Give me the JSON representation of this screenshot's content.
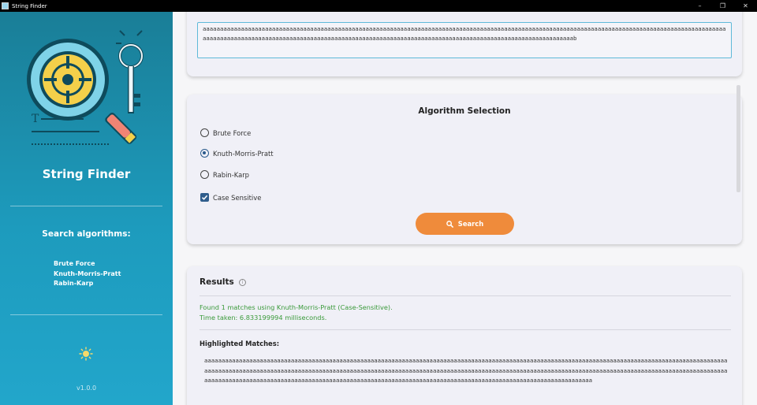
{
  "window": {
    "title": "String Finder",
    "controls": {
      "minimize": "–",
      "maximize": "❐",
      "close": "✕"
    }
  },
  "sidebar": {
    "app_name": "String Finder",
    "algorithms_heading": "Search algorithms:",
    "algorithms": [
      "Brute Force",
      "Knuth-Morris-Pratt",
      "Rabin-Karp"
    ],
    "theme_icon": "sun-icon",
    "version": "v1.0.0"
  },
  "input": {
    "text": "aaaaaaaaaaaaaaaaaaaaaaaaaaaaaaaaaaaaaaaaaaaaaaaaaaaaaaaaaaaaaaaaaaaaaaaaaaaaaaaaaaaaaaaaaaaaaaaaaaaaaaaaaaaaaaaaaaaaaaaaaaaaaaaaaaaaaaaaaaaaaaaaaaaaaaaaaaaaaaaaaaaaaaaaaaaaaaaaaaaaaaaaaaaaaaaaaaaaaaaaaaaaaaaaaaaaaaaaaaaaaaaaaaaaaaaaaaaaaaaaaaaaaaaaaaaaaaaaaab"
  },
  "algorithm_selection": {
    "heading": "Algorithm Selection",
    "options": [
      {
        "label": "Brute Force",
        "checked": false
      },
      {
        "label": "Knuth-Morris-Pratt",
        "checked": true
      },
      {
        "label": "Rabin-Karp",
        "checked": false
      }
    ],
    "case_sensitive_label": "Case Sensitive",
    "case_sensitive_checked": true,
    "search_label": "Search",
    "search_icon": "search-icon"
  },
  "results": {
    "title": "Results",
    "info_icon": "info-icon",
    "status_line_1": "Found 1 matches using Knuth-Morris-Pratt (Case-Sensitive).",
    "status_line_2": "Time taken: 6.833199994 milliseconds.",
    "matches_label": "Highlighted Matches:",
    "matches_text": "aaaaaaaaaaaaaaaaaaaaaaaaaaaaaaaaaaaaaaaaaaaaaaaaaaaaaaaaaaaaaaaaaaaaaaaaaaaaaaaaaaaaaaaaaaaaaaaaaaaaaaaaaaaaaaaaaaaaaaaaaaaaaaaaaaaaaaaaaaaaaaaaaaaaaaaaaaaaaaaaaaaaaaaaaaaaaaaaaaaaaaaaaaaaaaaaaaaaaaaaaaaaaaaaaaaaaaaaaaaaaaaaaaaaaaaaaaaaaaaaaaaaaaaaaaaaaaaaaaaaaaaaaaaaaaaaaaaaaaaaaaaaaaaaaaaaaaaaaaaaaaaaaaaaaaaaaaaaaaaaaaaaaaaaaaaaaaaaaaaaaaaaaaaaaaaaaaaaaaaaaaaaaaaaaaaaaaaaaaaaaaaaaaaaaaaaaaaaaaaaaaaaaaaaaaaaaa"
  },
  "colors": {
    "sidebar_top": "#1a7e97",
    "sidebar_bottom": "#22a6cb",
    "accent_orange": "#ef8b3b",
    "success_green": "#3a9a3a",
    "radio_checked": "#2a5a8c"
  }
}
